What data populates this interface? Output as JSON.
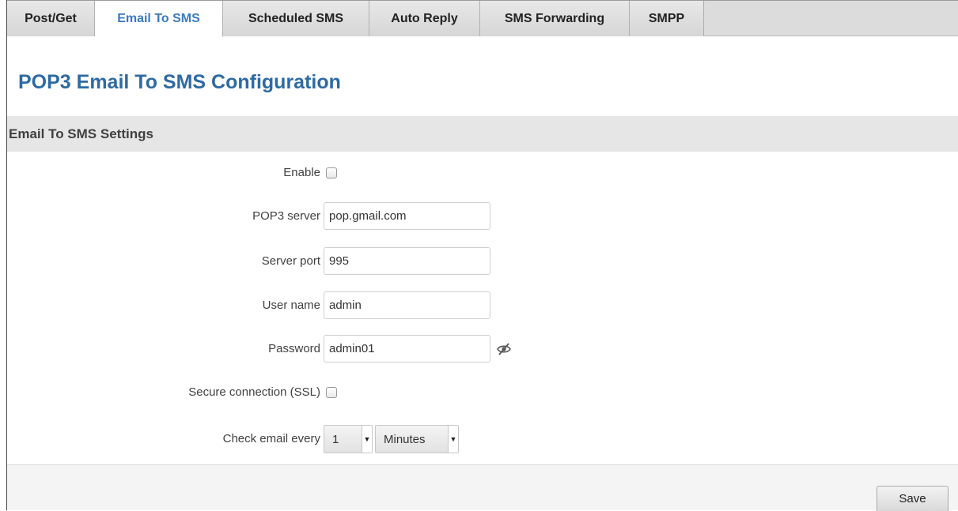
{
  "tabs": [
    {
      "label": "Post/Get",
      "active": false
    },
    {
      "label": "Email To SMS",
      "active": true
    },
    {
      "label": "Scheduled SMS",
      "active": false
    },
    {
      "label": "Auto Reply",
      "active": false
    },
    {
      "label": "SMS Forwarding",
      "active": false
    },
    {
      "label": "SMPP",
      "active": false
    }
  ],
  "page_title": "POP3 Email To SMS Configuration",
  "section_title": "Email To SMS Settings",
  "form": {
    "enable": {
      "label": "Enable",
      "checked": false
    },
    "pop3_server": {
      "label": "POP3 server",
      "value": "pop.gmail.com"
    },
    "server_port": {
      "label": "Server port",
      "value": "995"
    },
    "user_name": {
      "label": "User name",
      "value": "admin"
    },
    "password": {
      "label": "Password",
      "value": "admin01"
    },
    "secure_connection": {
      "label": "Secure connection (SSL)",
      "checked": false
    },
    "check_email": {
      "label": "Check email every",
      "interval_value": "1",
      "unit_value": "Minutes"
    }
  },
  "footer": {
    "save_label": "Save"
  },
  "icons": {
    "password_visibility": "eye-slash-icon"
  },
  "colors": {
    "accent": "#2e6aa3",
    "active_tab_text": "#3a7bbf",
    "tab_bar": "#dcdcdc",
    "section_bg": "#e6e6e6"
  }
}
